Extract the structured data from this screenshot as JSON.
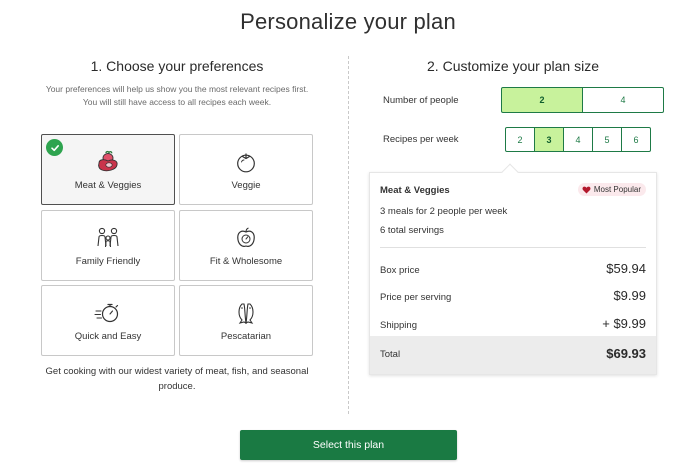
{
  "page": {
    "title": "Personalize your plan"
  },
  "preferences": {
    "heading": "1. Choose your preferences",
    "intro": "Your preferences will help us show you the most relevant recipes first. You will still have access to all recipes each week.",
    "tiles": [
      {
        "label": "Meat & Veggies",
        "icon": "meat-veggies-icon",
        "selected": true
      },
      {
        "label": "Veggie",
        "icon": "tomato-icon",
        "selected": false
      },
      {
        "label": "Family Friendly",
        "icon": "family-icon",
        "selected": false
      },
      {
        "label": "Fit & Wholesome",
        "icon": "apple-scale-icon",
        "selected": false
      },
      {
        "label": "Quick and Easy",
        "icon": "stopwatch-icon",
        "selected": false
      },
      {
        "label": "Pescatarian",
        "icon": "fish-icon",
        "selected": false
      }
    ],
    "description": "Get cooking with our widest variety of meat, fish, and seasonal produce."
  },
  "plan_size": {
    "heading": "2. Customize your plan size",
    "people": {
      "label": "Number of people",
      "options": [
        "2",
        "4"
      ],
      "selected": "2"
    },
    "recipes": {
      "label": "Recipes per week",
      "options": [
        "2",
        "3",
        "4",
        "5",
        "6"
      ],
      "selected": "3"
    }
  },
  "summary": {
    "title": "Meat & Veggies",
    "badge": "Most Popular",
    "meals_line": "3 meals for 2 people per week",
    "servings_line": "6 total servings",
    "box_price_label": "Box price",
    "box_price": "$59.94",
    "per_serving_label": "Price per serving",
    "per_serving": "$9.99",
    "shipping_label": "Shipping",
    "shipping": "+ $9.99",
    "total_label": "Total",
    "total": "$69.93"
  },
  "cta": {
    "label": "Select this plan"
  },
  "colors": {
    "accent": "#1a7a43",
    "selected_fill": "#c8f29c",
    "check": "#2ea44f",
    "badge_heart": "#b3182c"
  }
}
